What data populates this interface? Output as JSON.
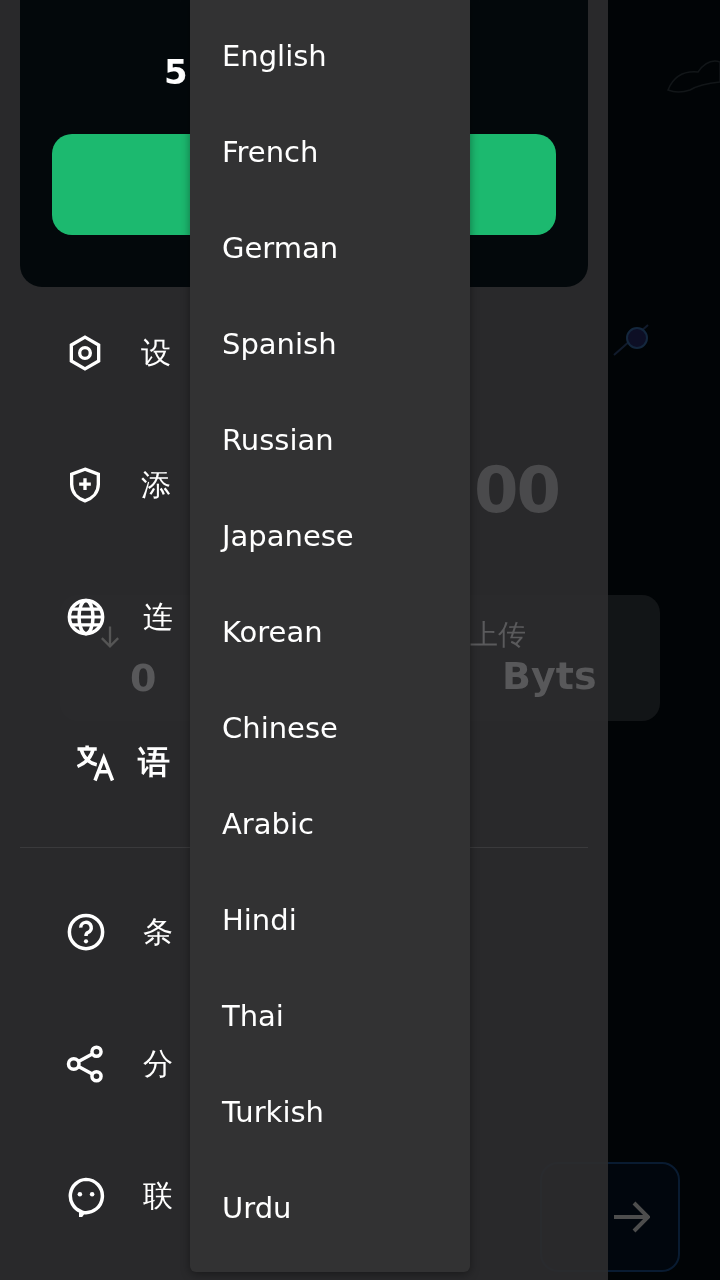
{
  "main": {
    "timer": "00",
    "stats": {
      "download_value": "0",
      "upload_label": "上传",
      "upload_value": "Byts"
    }
  },
  "drawer": {
    "header": {
      "title": "5"
    },
    "menu_groups": [
      [
        {
          "kind": "settings",
          "label": "设",
          "selected": false
        },
        {
          "kind": "shield",
          "label": "添",
          "selected": false
        },
        {
          "kind": "globe",
          "label": "连",
          "selected": false
        },
        {
          "kind": "translate",
          "label": "语",
          "selected": true
        }
      ],
      [
        {
          "kind": "help",
          "label": "条",
          "selected": false
        },
        {
          "kind": "share",
          "label": "分",
          "selected": false
        },
        {
          "kind": "chat",
          "label": "联",
          "selected": false
        }
      ]
    ]
  },
  "dropdown": {
    "items": [
      "English",
      "French",
      "German",
      "Spanish",
      "Russian",
      "Japanese",
      "Korean",
      "Chinese",
      "Arabic",
      "Hindi",
      "Thai",
      "Turkish",
      "Urdu"
    ]
  }
}
